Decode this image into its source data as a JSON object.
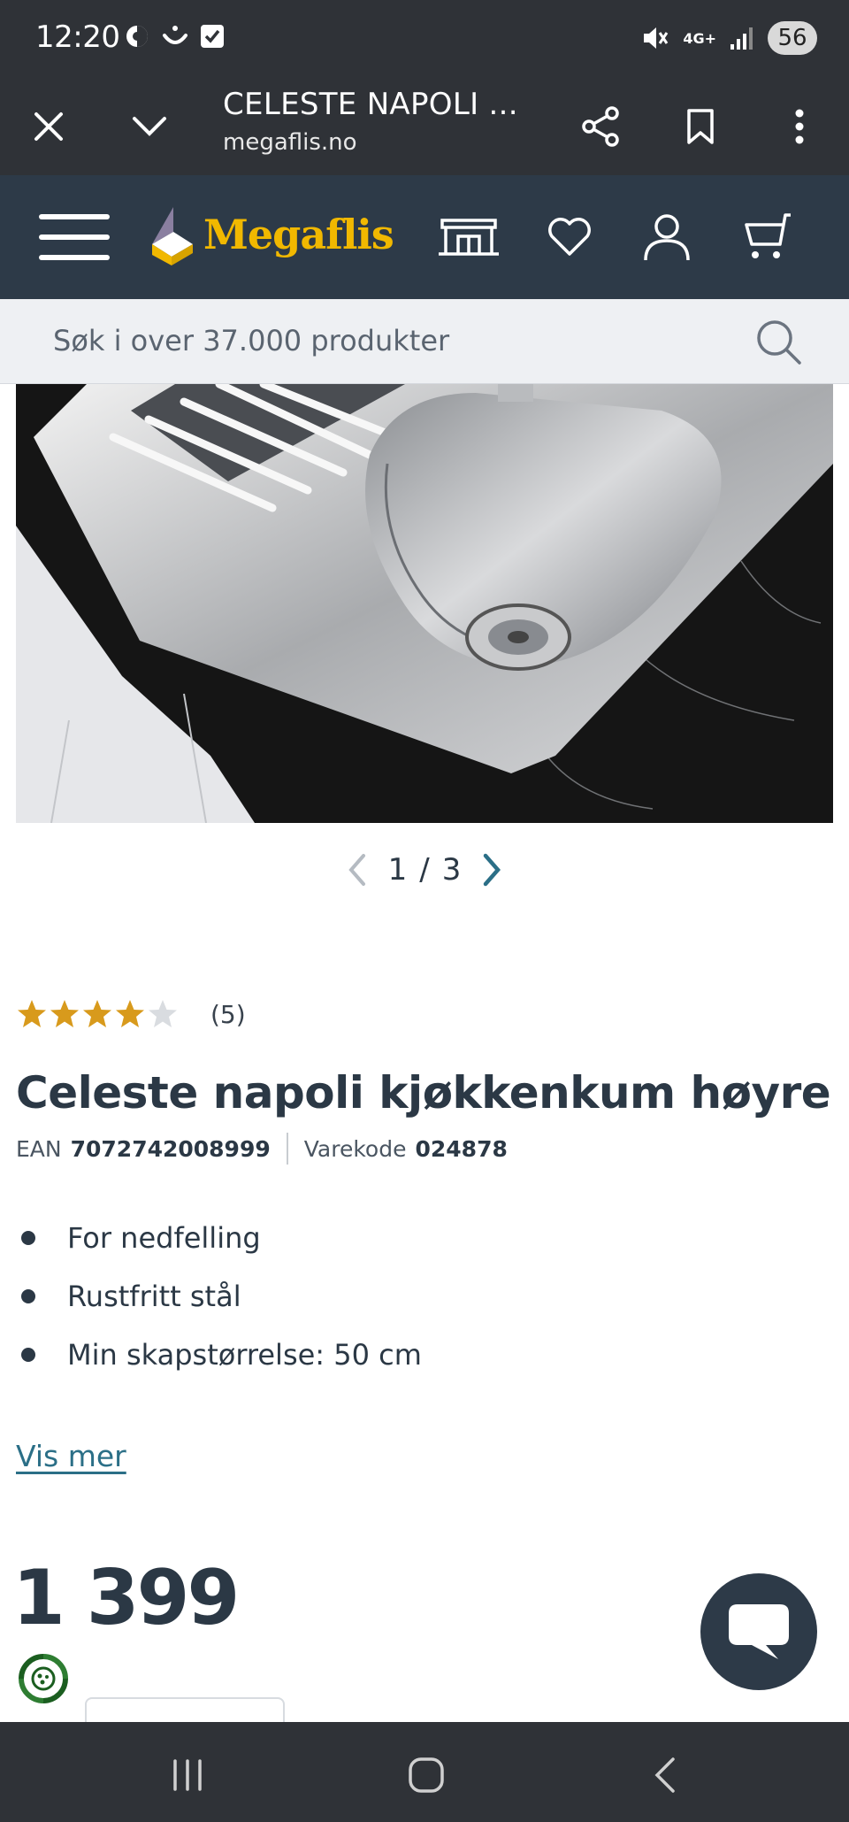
{
  "status_bar": {
    "time": "12:20",
    "network": "4G+",
    "battery": "56"
  },
  "browser": {
    "page_title": "CELESTE NAPOLI ...",
    "url": "megaflis.no"
  },
  "site": {
    "brand": "Megaflis",
    "brand_color": "#f1b800",
    "header_bg": "#2d3a48",
    "icons": [
      "menu-icon",
      "store-icon",
      "heart-icon",
      "user-icon",
      "cart-icon"
    ]
  },
  "search": {
    "placeholder": "Søk i over 37.000 produkter"
  },
  "gallery": {
    "current": "1",
    "separator": "/",
    "total": "3"
  },
  "product": {
    "rating_value": 4.6,
    "rating_count": "(5)",
    "title": "Celeste napoli kjøkkenkum høyre",
    "ean_label": "EAN",
    "ean_value": "7072742008999",
    "code_label": "Varekode",
    "code_value": "024878",
    "features": [
      "For nedfelling",
      "Rustfritt stål",
      "Min skapstørrelse: 50 cm"
    ],
    "show_more": "Vis mer",
    "price": "1 399"
  },
  "colors": {
    "text": "#2b3845",
    "link": "#2b6f87",
    "star": "#d89a1c"
  }
}
